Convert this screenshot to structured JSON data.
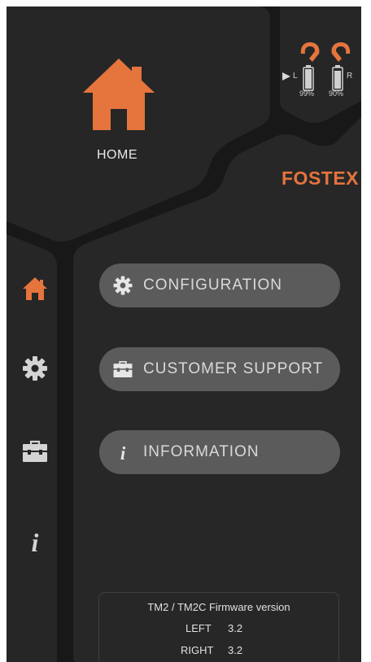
{
  "home": {
    "title": "HOME"
  },
  "brand": {
    "name": "FOSTEX",
    "color": "#e5743d"
  },
  "battery": {
    "left": {
      "side": "L",
      "percent": "99%"
    },
    "right": {
      "side": "R",
      "percent": "90%"
    }
  },
  "sidebar": {
    "items": [
      {
        "icon": "home-icon",
        "active": true
      },
      {
        "icon": "gear-icon",
        "active": false
      },
      {
        "icon": "toolbox-icon",
        "active": false
      },
      {
        "icon": "info-icon",
        "active": false
      }
    ]
  },
  "menu": {
    "configuration": "CONFIGURATION",
    "customer_support": "CUSTOMER SUPPORT",
    "information": "INFORMATION"
  },
  "firmware": {
    "title": "TM2 / TM2C Firmware version",
    "left_label": "LEFT",
    "left_value": "3.2",
    "right_label": "RIGHT",
    "right_value": "3.2"
  },
  "colors": {
    "accent": "#e5743d",
    "panel": "#262626",
    "background": "#181818",
    "button": "#5b5b5b"
  }
}
